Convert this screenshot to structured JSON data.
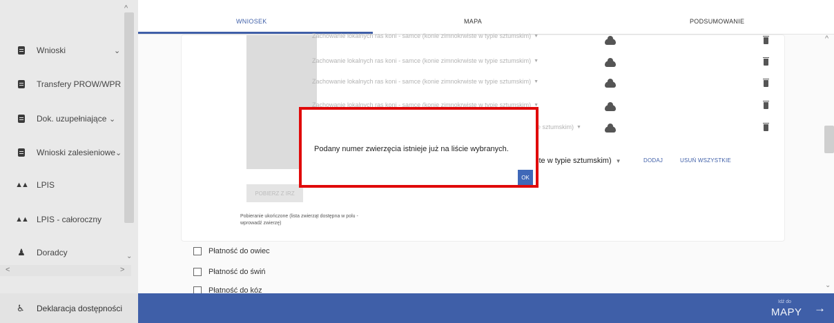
{
  "sidebar": {
    "items": [
      {
        "label": "Wnioski",
        "icon": "document-icon",
        "has_chevron": true
      },
      {
        "label": "Transfery PROW/WPR",
        "icon": "document-icon",
        "has_chevron": false
      },
      {
        "label": "Dok. uzupełniające",
        "icon": "document-icon",
        "has_chevron": true
      },
      {
        "label": "Wnioski zalesieniowe",
        "icon": "document-icon",
        "has_chevron": true
      },
      {
        "label": "LPIS",
        "icon": "terrain-icon",
        "has_chevron": false
      },
      {
        "label": "LPIS - całoroczny",
        "icon": "terrain-icon",
        "has_chevron": false
      },
      {
        "label": "Doradcy",
        "icon": "person-icon",
        "has_chevron": false
      }
    ],
    "footer_label": "Deklaracja dostępności"
  },
  "tabs": [
    {
      "label": "WNIOSEK",
      "active": true
    },
    {
      "label": "MAPA",
      "active": false
    },
    {
      "label": "PODSUMOWANIE",
      "active": false
    }
  ],
  "main": {
    "download_button": "POBIERZ Z IRZ",
    "download_status": "Pobieranie ukończone (lista zwierząt dostępna w polu - wprowadź zwierzę)",
    "breed_rows": [
      "Zachowanie lokalnych ras koni - samce (konie zimnokrwiste w typie sztumskim)",
      "Zachowanie lokalnych ras koni - samce (konie zimnokrwiste w typie sztumskim)",
      "Zachowanie lokalnych ras koni - samce (konie zimnokrwiste w typie sztumskim)",
      "Zachowanie lokalnych ras koni - samce (konie zimnokrwiste w typie sztumskim)",
      "e sztumskim)"
    ],
    "select_value_partial": "ste w typie sztumskim)",
    "add_button": "DODAJ",
    "remove_all_button": "USUŃ WSZYSTKIE",
    "checkboxes": [
      "Płatność do owiec",
      "Płatność do świń",
      "Płatność do kóz"
    ]
  },
  "bottom_bar": {
    "next_small": "Idź do",
    "next_label": "MAPY"
  },
  "dialog": {
    "message": "Podany numer zwierzęcia istnieje już na liście wybranych.",
    "ok_label": "OK",
    "highlight_color": "#e00a0a"
  },
  "colors": {
    "accent": "#3f5fa8",
    "sidebar_bg": "#e9e9e9"
  }
}
